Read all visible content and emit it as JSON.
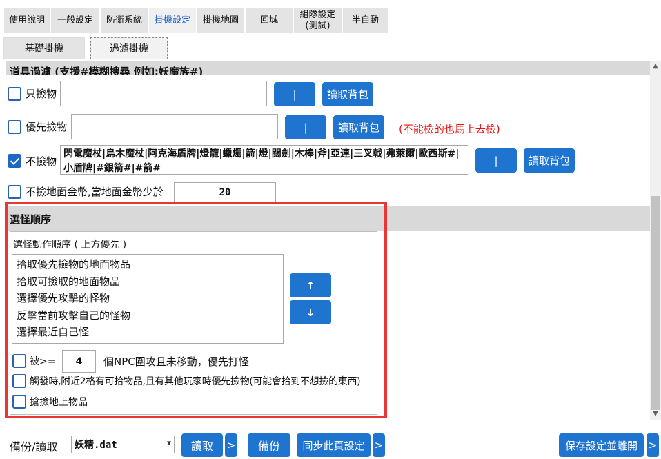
{
  "tabs": [
    {
      "label": "使用說明"
    },
    {
      "label": "一般設定"
    },
    {
      "label": "防衛系統"
    },
    {
      "label": "掛機設定"
    },
    {
      "label": "掛機地圖"
    },
    {
      "label": "回城"
    },
    {
      "label": "組隊設定\n(測試)"
    },
    {
      "label": "半自動"
    }
  ],
  "subtabs": [
    {
      "label": "基礎掛機"
    },
    {
      "label": "過濾掛機"
    }
  ],
  "item_filter": {
    "header": "道具過濾 (支援#模糊搜尋 例如:妖魔族#)",
    "only_pick": {
      "label": "只撿物",
      "checked": false,
      "value": "",
      "sep_btn": "|",
      "read_btn": "讀取背包"
    },
    "priority_pick": {
      "label": "優先撿物",
      "checked": false,
      "value": "",
      "sep_btn": "|",
      "read_btn": "讀取背包",
      "note": "(不能檢的也馬上去檢)"
    },
    "no_pick": {
      "label": "不撿物",
      "checked": true,
      "value": "閃電魔杖|烏木魔杖|阿克海盾牌|燈籠|蠟燭|箭|燈|闊劍|木棒|斧|亞連|三叉戟|弗萊爾|歐西斯#|小盾牌|#銀箭#|#箭#",
      "sep_btn": "|",
      "read_btn": "讀取背包"
    },
    "no_gold": {
      "label": "不撿地面金幣,當地面金幣少於",
      "checked": false,
      "value": "20"
    }
  },
  "target_order": {
    "header": "選怪順序",
    "sub_label": "選怪動作順序 ( 上方優先 )",
    "items": [
      "拾取優先撿物的地面物品",
      "拾取可撿取的地面物品",
      "選擇優先攻擊的怪物",
      "反擊當前攻擊自己的怪物",
      "選擇最近自己怪"
    ],
    "up_btn": "↑",
    "down_btn": "↓",
    "opt_siege": {
      "prefix": "被>=",
      "value": "4",
      "suffix": "個NPC圍攻且未移動，優先打怪",
      "checked": false
    },
    "opt_trigger": {
      "label": "觸發時,附近2格有可拾物品,且有其他玩家時優先撿物(可能會拾到不想撿的東西)",
      "checked": false
    },
    "opt_grab": {
      "label": "搶撿地上物品",
      "checked": false
    }
  },
  "footer": {
    "backup_label": "備份/讀取",
    "file_value": "妖精.dat",
    "read_btn": "讀取",
    "more1": ">",
    "backup_btn": "備份",
    "sync_btn": "同步此頁設定",
    "more2": ">",
    "save_btn": "保存設定並離開",
    "more3": ">"
  },
  "colors": {
    "accent": "#1f74cf",
    "highlight_frame": "#e83535",
    "warning": "#e11111",
    "group_header": "#d9d9d9"
  }
}
